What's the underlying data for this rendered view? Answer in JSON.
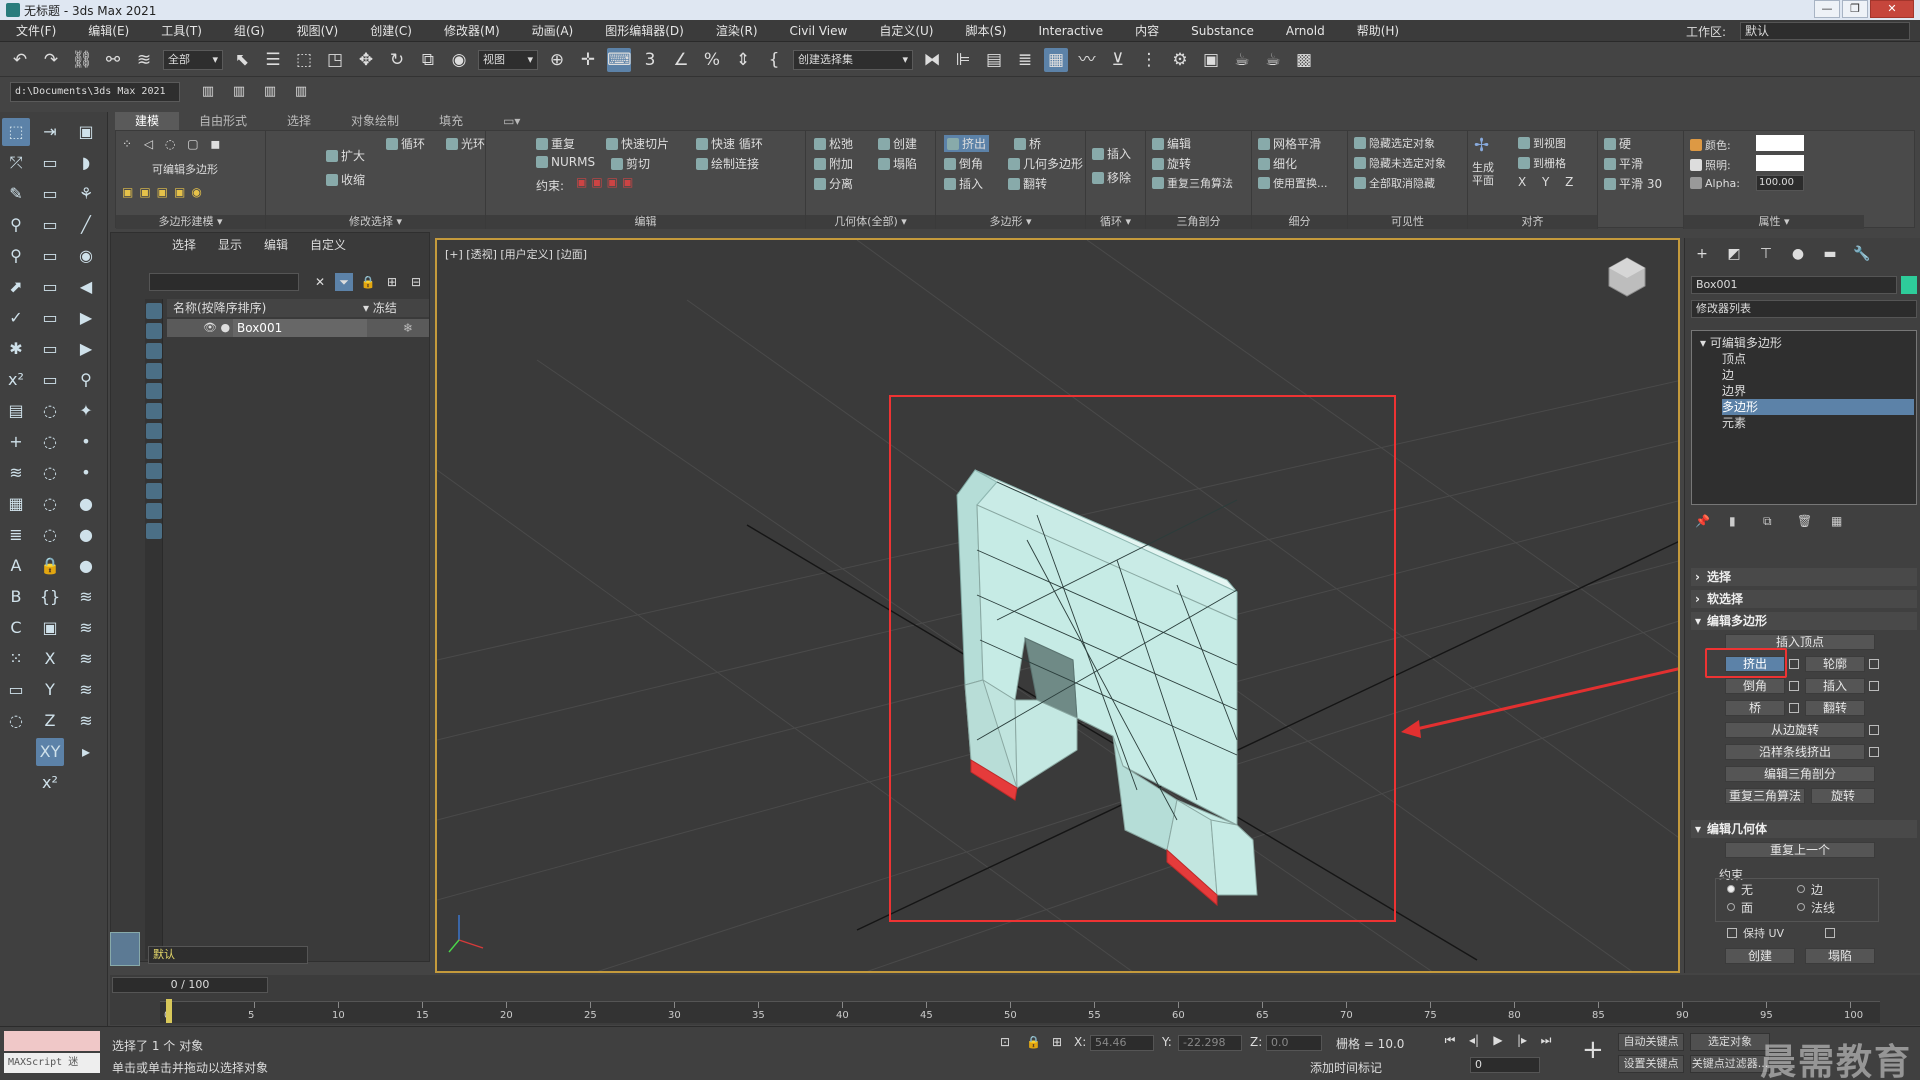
{
  "window": {
    "title": "无标题 - 3ds Max 2021",
    "controls": [
      "—",
      "❐",
      "✕"
    ]
  },
  "menubar": {
    "items": [
      "文件(F)",
      "编辑(E)",
      "工具(T)",
      "组(G)",
      "视图(V)",
      "创建(C)",
      "修改器(M)",
      "动画(A)",
      "图形编辑器(D)",
      "渲染(R)",
      "Civil View",
      "自定义(U)",
      "脚本(S)",
      "Interactive",
      "内容",
      "Substance",
      "Arnold",
      "帮助(H)"
    ],
    "workspace_label": "工作区:",
    "workspace_value": "默认"
  },
  "toolbar": {
    "filter_drop": "全部",
    "view_drop": "视图",
    "selection_set_drop": "创建选择集",
    "path": "d:\\Documents\\3ds Max 2021"
  },
  "ribbon": {
    "tabs": [
      "建模",
      "自由形式",
      "选择",
      "对象绘制",
      "填充"
    ],
    "groups": {
      "poly_modeling": "多边形建模",
      "poly_modeling_sub": "可编辑多边形",
      "modify_selection": "修改选择",
      "edit": "编辑",
      "geometry": "几何体(全部)",
      "polygons": "多边形",
      "loops": "循环",
      "tris": "三角剖分",
      "subdivision": "细分",
      "visibility": "可见性",
      "align": "对齐",
      "properties": "属性"
    },
    "items": {
      "loop": "循环",
      "ring": "光环",
      "grow": "扩大",
      "shrink": "收缩",
      "repeat": "重复",
      "quickslice": "快速切片",
      "swiftloop": "快速 循环",
      "nurms": "NURMS",
      "cut": "剪切",
      "paintconnect": "绘制连接",
      "constraint": "约束:",
      "relax": "松弛",
      "create": "创建",
      "attach": "附加",
      "collapse": "塌陷",
      "detach": "分离",
      "extrude": "挤出",
      "bridge": "桥",
      "bevel": "倒角",
      "geopoly": "几何多边形",
      "insert": "插入",
      "flip": "翻转",
      "insert_loop": "插入",
      "remove_loop": "移除",
      "edit_tri": "编辑",
      "turn": "旋转",
      "retri": "重复三角算法",
      "meshsmooth": "网格平滑",
      "tessellate": "细化",
      "use_displace": "使用置换...",
      "hide_sel": "隐藏选定对象",
      "hide_unsel": "隐藏未选定对象",
      "unhide_all": "全部取消隐藏",
      "make_planar": "生成\n平面",
      "to_view": "到视图",
      "to_grid": "到栅格",
      "hard": "硬",
      "smooth": "平滑",
      "smooth30": "平滑 30",
      "color": "颜色:",
      "illum": "照明:",
      "alpha": "Alpha:",
      "alpha_val": "100.00"
    }
  },
  "scene_explorer": {
    "tabs": [
      "选择",
      "显示",
      "编辑",
      "自定义"
    ],
    "col_name": "名称(按降序排序)",
    "col_frozen": "▾ 冻结",
    "rows": [
      {
        "name": "Box001"
      }
    ],
    "layer": "默认"
  },
  "viewport": {
    "label": "[+] [透视] [用户定义] [边面]"
  },
  "command_panel": {
    "object_name": "Box001",
    "modifier_list": "修改器列表",
    "stack": {
      "root": "可编辑多边形",
      "subs": [
        "顶点",
        "边",
        "边界",
        "多边形",
        "元素"
      ],
      "selected": "多边形"
    },
    "rollouts": {
      "selection": "选择",
      "soft_selection": "软选择",
      "edit_polygons": "编辑多边形",
      "edit_geometry": "编辑几何体"
    },
    "edit_polygons": {
      "insert_vertex": "插入顶点",
      "extrude": "挤出",
      "outline": "轮廓",
      "bevel": "倒角",
      "inset": "插入",
      "bridge": "桥",
      "flip": "翻转",
      "hinge": "从边旋转",
      "extrude_spline": "沿样条线挤出",
      "edit_tri": "编辑三角剖分",
      "retriangulate": "重复三角算法",
      "turn": "旋转"
    },
    "edit_geometry": {
      "repeat_last": "重复上一个",
      "constraints": "约束",
      "none": "无",
      "edge": "边",
      "face": "面",
      "normal": "法线",
      "preserve_uv": "保持 UV",
      "create": "创建",
      "collapse": "塌陷"
    }
  },
  "timeline": {
    "frame_display": "0 / 100",
    "ticks": [
      "0",
      "5",
      "10",
      "15",
      "20",
      "25",
      "30",
      "35",
      "40",
      "45",
      "50",
      "55",
      "60",
      "65",
      "70",
      "75",
      "80",
      "85",
      "90",
      "95",
      "100"
    ]
  },
  "status": {
    "maxscript": "MAXScript 迷",
    "selected": "选择了 1 个 对象",
    "prompt": "单击或单击并拖动以选择对象",
    "x_label": "X:",
    "x_val": "54.46",
    "y_label": "Y:",
    "y_val": "-22.298",
    "z_label": "Z:",
    "z_val": "0.0",
    "grid": "栅格 = 10.0",
    "add_time_tag": "添加时间标记",
    "auto_key": "自动关键点",
    "selected_obj": "选定对象",
    "set_key": "设置关键点",
    "key_filters": "关键点过滤器...",
    "frame_field": "0"
  },
  "watermark": "晨需教育"
}
